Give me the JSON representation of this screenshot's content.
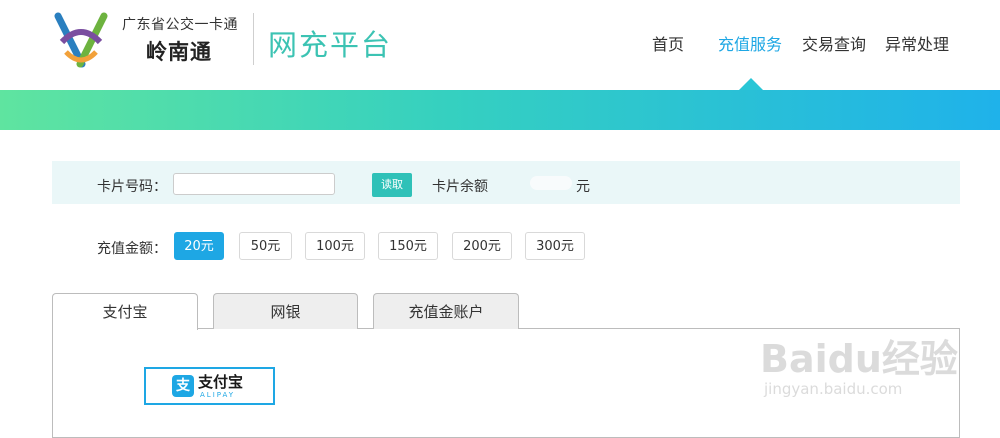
{
  "header": {
    "org_name": "广东省公交一卡通",
    "brand_name": "岭南通",
    "platform_name": "网充平台",
    "nav": [
      {
        "label": "首页",
        "active": false
      },
      {
        "label": "充值服务",
        "active": true
      },
      {
        "label": "交易查询",
        "active": false
      },
      {
        "label": "异常处理",
        "active": false
      }
    ]
  },
  "card": {
    "number_label": "卡片号码：",
    "number_value": "",
    "read_button": "读取",
    "balance_label": "卡片余额",
    "balance_unit": "元"
  },
  "amount": {
    "label": "充值金额：",
    "options": [
      "20元",
      "50元",
      "100元",
      "150元",
      "200元",
      "300元"
    ],
    "selected": "20元"
  },
  "payment_tabs": [
    {
      "label": "支付宝",
      "active": true
    },
    {
      "label": "网银",
      "active": false
    },
    {
      "label": "充值金账户",
      "active": false
    }
  ],
  "alipay_logo": {
    "name": "支付宝",
    "en": "ALIPAY"
  },
  "watermark": {
    "main": "Baidu经验",
    "sub": "jingyan.baidu.com"
  },
  "colors": {
    "accent": "#1ea7e4",
    "teal": "#3cc3b3",
    "read_button": "#2fc1b8"
  }
}
